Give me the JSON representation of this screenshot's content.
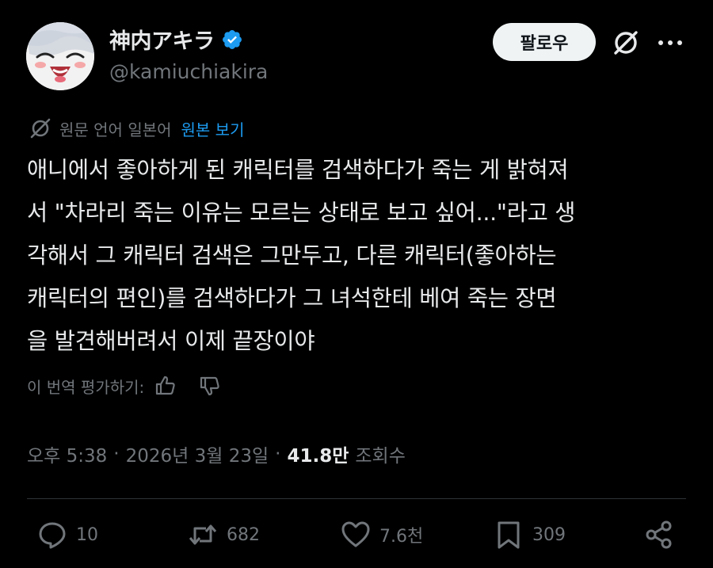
{
  "author": {
    "display_name": "神内アキラ",
    "handle": "@kamiuchiakira"
  },
  "follow_label": "팔로우",
  "translation": {
    "label": "원문 언어 일본어",
    "show_original": "원본 보기"
  },
  "tweet_text": "애니에서 좋아하게 된 캐릭터를 검색하다가 죽는 게 밝혀져\n서 \"차라리 죽는 이유는 모르는 상태로 보고 싶어...\"라고 생\n각해서 그 캐릭터 검색은 그만두고, 다른 캐릭터(좋아하는\n캐릭터의 편인)를 검색하다가 그 녀석한테 베여 죽는 장면\n을 발견해버려서 이제 끝장이야",
  "rate_translation": "이 번역 평가하기:",
  "meta": {
    "time": "오후 5:38",
    "date": "2026년 3월 23일",
    "views_count": "41.8만",
    "views_label": "조회수",
    "separator": "·"
  },
  "actions": {
    "replies": "10",
    "reposts": "682",
    "likes": "7.6천",
    "bookmarks": "309"
  },
  "colors": {
    "background": "#000000",
    "text": "#e7e9ea",
    "muted": "#71767b",
    "accent": "#1d9bf0",
    "follow_button_bg": "#eff3f4"
  },
  "icons": {
    "verified": "verified-badge-icon",
    "grok": "grok-icon",
    "more": "more-icon",
    "translate": "grok-translate-icon",
    "thumbs_up": "thumbs-up-icon",
    "thumbs_down": "thumbs-down-icon",
    "reply": "reply-icon",
    "repost": "repost-icon",
    "like": "heart-icon",
    "bookmark": "bookmark-icon",
    "share": "share-icon"
  }
}
